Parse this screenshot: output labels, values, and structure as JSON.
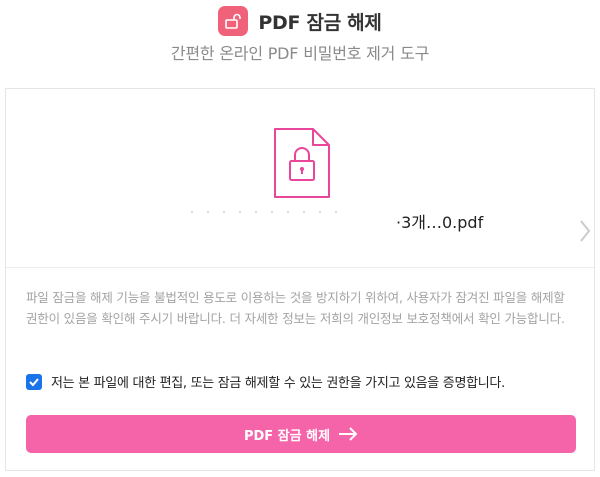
{
  "header": {
    "title": "PDF 잠금 해제",
    "subtitle": "간편한 온라인 PDF 비밀번호 제거 도구",
    "logo_icon": "unlocked-padlock-icon"
  },
  "file": {
    "icon": "locked-pdf-file-icon",
    "name": "·3개…0.pdf",
    "next_icon": "chevron-right-icon"
  },
  "notice": {
    "text": "파일 잠금을 해제 기능을 불법적인 용도로 이용하는 것을 방지하기 위하여, 사용자가 잠겨진 파일을 해제할 권한이 있음을 확인해 주시기 바랍니다. 더 자세한 정보는 저희의 개인정보 보호정책에서 확인 가능합니다."
  },
  "consent": {
    "checked": true,
    "label": "저는 본 파일에 대한 편집, 또는 잠금 해제할 수 있는 권한을 가지고 있음을 증명합니다."
  },
  "action": {
    "label": "PDF 잠금 해제",
    "icon": "arrow-right-icon"
  },
  "colors": {
    "accent": "#f564a9",
    "logo": "#f0627a",
    "icon_stroke": "#e8469a",
    "checkbox": "#1a73e8"
  }
}
